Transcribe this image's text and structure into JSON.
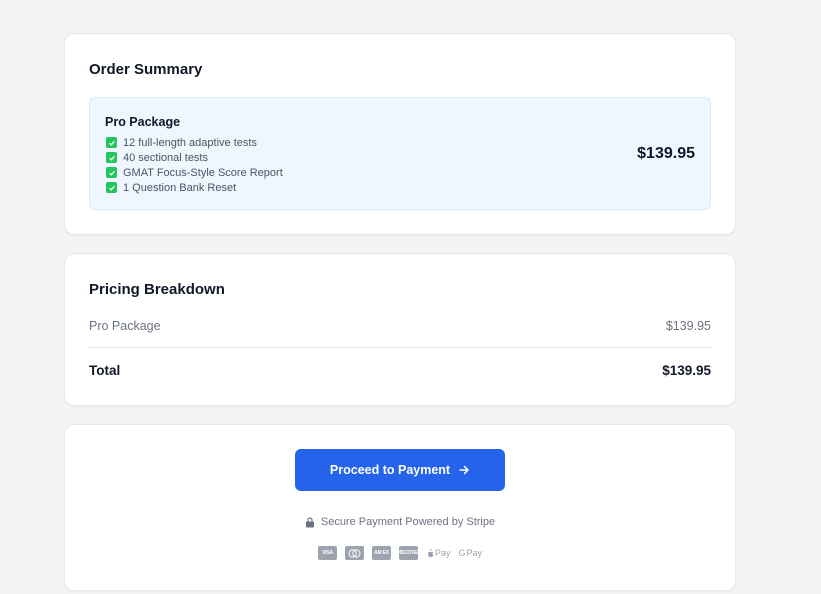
{
  "order_summary": {
    "title": "Order Summary",
    "package": {
      "name": "Pro Package",
      "price": "$139.95",
      "features": [
        "12 full-length adaptive tests",
        "40 sectional tests",
        "GMAT Focus-Style Score Report",
        "1 Question Bank Reset"
      ]
    }
  },
  "pricing_breakdown": {
    "title": "Pricing Breakdown",
    "line_item": {
      "label": "Pro Package",
      "amount": "$139.95"
    },
    "total": {
      "label": "Total",
      "amount": "$139.95"
    }
  },
  "payment": {
    "button_label": "Proceed to Payment",
    "secure_text": "Secure Payment Powered by Stripe",
    "methods": [
      {
        "icon": "visa-icon",
        "label": "VISA"
      },
      {
        "icon": "mastercard-icon",
        "label": ""
      },
      {
        "icon": "amex-icon",
        "label": "AM EX"
      },
      {
        "icon": "discover-icon",
        "label": "DISCOVER"
      },
      {
        "icon": "apple-pay-icon",
        "label": "Pay"
      },
      {
        "icon": "google-pay-icon",
        "label": "Pay"
      }
    ]
  },
  "colors": {
    "accent": "#2563eb",
    "check": "#22c55e",
    "package_bg": "#eff6ff",
    "page_bg": "#f3f4f6"
  }
}
